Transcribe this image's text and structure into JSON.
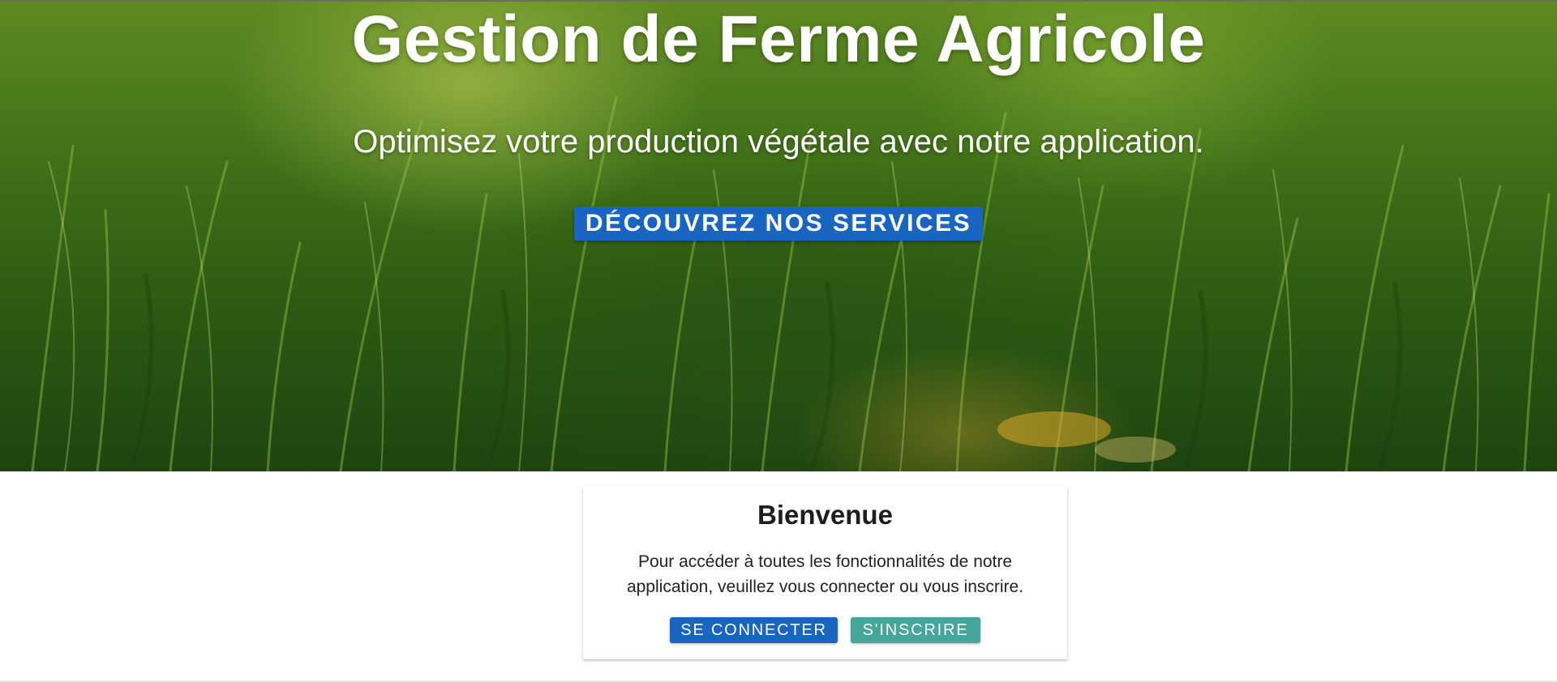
{
  "hero": {
    "title": "Gestion de Ferme Agricole",
    "subtitle": "Optimisez votre production végétale avec notre application.",
    "cta_label": "DÉCOUVREZ NOS SERVICES"
  },
  "welcome": {
    "title": "Bienvenue",
    "text": "Pour accéder à toutes les fonctionnalités de notre application, veuillez vous connecter ou vous inscrire.",
    "login_label": "SE CONNECTER",
    "signup_label": "S'INSCRIRE"
  },
  "colors": {
    "primary": "#1a65c2",
    "secondary": "#47a69a",
    "hero_green": "#3f7018"
  }
}
